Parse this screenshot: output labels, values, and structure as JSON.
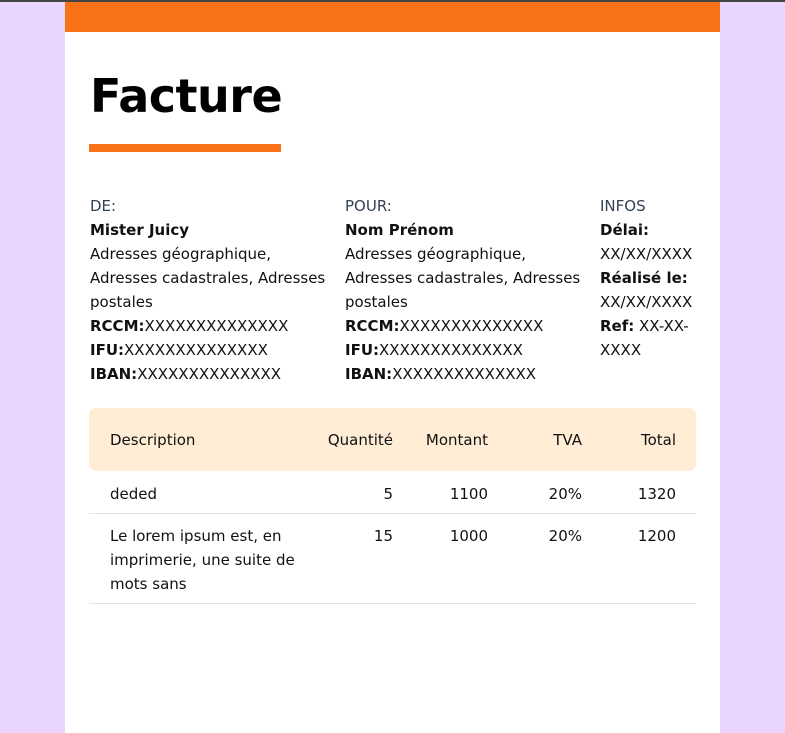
{
  "invoice": {
    "title": "Facture",
    "from": {
      "heading": "DE:",
      "name": "Mister Juicy",
      "address": "Adresses géographique, Adresses cadastrales, Adresses postales",
      "rccm_label": "RCCM:",
      "rccm_value": "XXXXXXXXXXXXXX",
      "ifu_label": "IFU:",
      "ifu_value": "XXXXXXXXXXXXXX",
      "iban_label": "IBAN:",
      "iban_value": "XXXXXXXXXXXXXX"
    },
    "to": {
      "heading": "POUR:",
      "name": "Nom Prénom",
      "address": "Adresses géographique, Adresses cadastrales, Adresses postales",
      "rccm_label": "RCCM:",
      "rccm_value": "XXXXXXXXXXXXXX",
      "ifu_label": "IFU:",
      "ifu_value": "XXXXXXXXXXXXXX",
      "iban_label": "IBAN:",
      "iban_value": "XXXXXXXXXXXXXX"
    },
    "infos": {
      "heading": "INFOS",
      "delai_label": "Délai:",
      "delai_value": "XX/XX/XXXX",
      "realise_label": "Réalisé le:",
      "realise_value": "XX/XX/XXXX",
      "ref_label": "Ref:",
      "ref_value": "XX-XX-XXXX"
    },
    "table": {
      "headers": [
        "Description",
        "Quantité",
        "Montant",
        "TVA",
        "Total"
      ],
      "rows": [
        [
          "deded",
          "5",
          "1100",
          "20%",
          "1320"
        ],
        [
          "Le lorem ipsum est, en imprimerie, une suite de mots sans",
          "15",
          "1000",
          "20%",
          "1200"
        ]
      ]
    },
    "colors": {
      "accent": "#f97316",
      "table_header_bg": "#ffedd5",
      "backdrop": "#e9d5ff"
    }
  }
}
